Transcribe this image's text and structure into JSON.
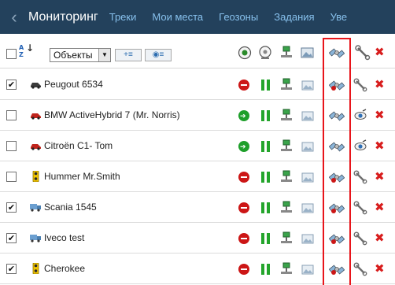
{
  "nav": {
    "back_icon": "chevron-left-icon",
    "title": "Мониторинг",
    "tabs": [
      {
        "label": "Треки"
      },
      {
        "label": "Мои места"
      },
      {
        "label": "Геозоны"
      },
      {
        "label": "Задания"
      },
      {
        "label": "Уве"
      }
    ],
    "colors": {
      "bar": "#23415c",
      "title": "#ffffff",
      "tab": "#87c0ec"
    }
  },
  "toolbar": {
    "select_all_checked": false,
    "sort_icon": "sort-az-icon",
    "sort_glyph_top": "A",
    "sort_glyph_bottom": "Z",
    "filter_select": {
      "value": "Объекты"
    },
    "add_button_glyph": "+≡",
    "view_button_glyph": "◉≡",
    "header_icons": [
      "locate-all-icon",
      "track-all-icon",
      "network-all-icon",
      "photo-all-icon",
      "satellite-all-icon",
      "settings-all-icon",
      "delete-all-icon"
    ]
  },
  "objects": [
    {
      "name": "Peugout 6534",
      "checked": true,
      "vehicle_icon": "car-black-icon",
      "state": "stop",
      "extra_icon": "wrench-icon"
    },
    {
      "name": "BMW ActiveHybrid 7 (Mr. Norris)",
      "checked": false,
      "vehicle_icon": "car-red-icon",
      "state": "go",
      "extra_icon": "eye-icon"
    },
    {
      "name": "Citroën C1- Tom",
      "checked": false,
      "vehicle_icon": "car-red-icon",
      "state": "go",
      "extra_icon": "eye-icon"
    },
    {
      "name": "Hummer Mr.Smith",
      "checked": false,
      "vehicle_icon": "traffic-light-icon",
      "state": "stop",
      "extra_icon": "wrench-icon"
    },
    {
      "name": "Scania 1545",
      "checked": true,
      "vehicle_icon": "truck-icon",
      "state": "stop",
      "extra_icon": "wrench-icon"
    },
    {
      "name": "Iveco test",
      "checked": true,
      "vehicle_icon": "truck-icon",
      "state": "stop",
      "extra_icon": "wrench-icon"
    },
    {
      "name": "Cherokee",
      "checked": true,
      "vehicle_icon": "traffic-light-icon",
      "state": "stop",
      "extra_icon": "wrench-icon"
    }
  ],
  "highlight_color": "#e8151b"
}
